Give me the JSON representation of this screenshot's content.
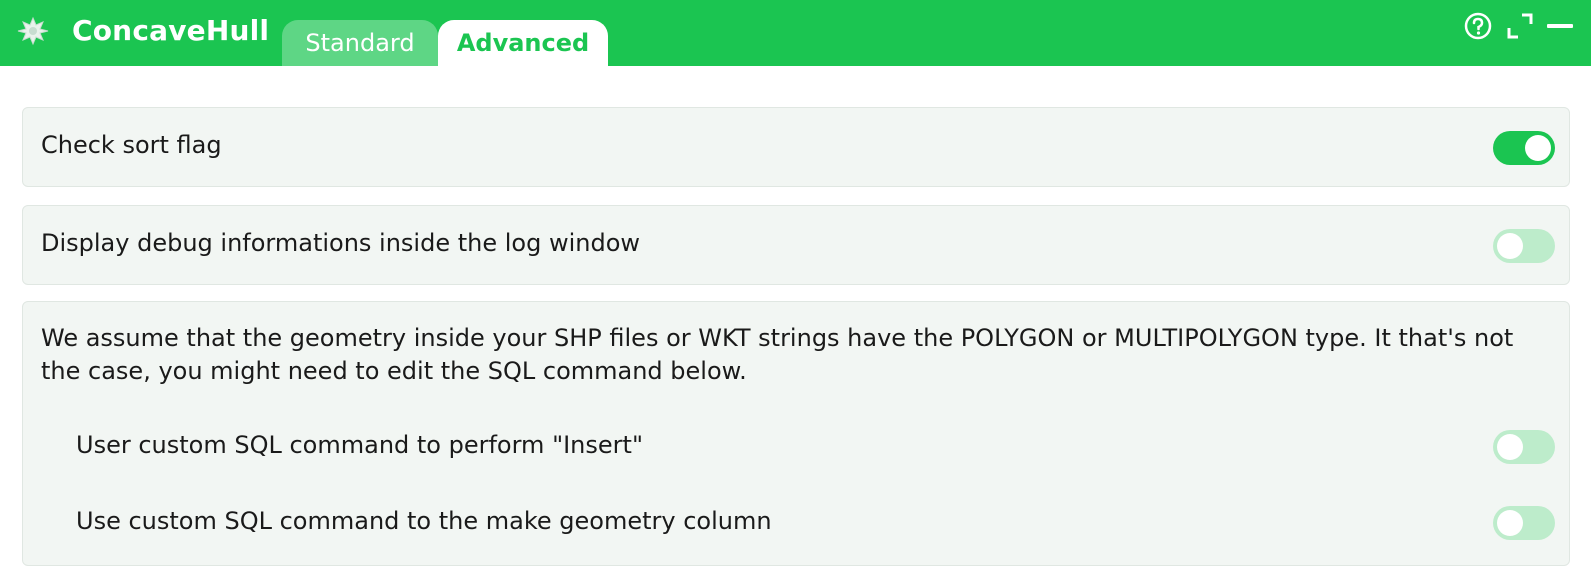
{
  "app": {
    "title": "ConcaveHull",
    "icon": "plugin-leaf-icon"
  },
  "tabs": [
    {
      "label": "Standard",
      "active": false
    },
    {
      "label": "Advanced",
      "active": true
    }
  ],
  "window_controls": [
    {
      "name": "help-icon"
    },
    {
      "name": "maximize-icon"
    },
    {
      "name": "minimize-icon"
    }
  ],
  "settings": {
    "check_sort": {
      "label": "Check sort flag",
      "enabled": true
    },
    "debug": {
      "label": "Display debug informations inside the log window",
      "enabled": false
    },
    "sql": {
      "note": "We assume that the geometry inside your SHP files or WKT strings have the POLYGON or MULTIPOLYGON type. It that's not the case, you might need to edit the SQL command below.",
      "custom_insert": {
        "label": "User custom SQL command to perform \"Insert\"",
        "enabled": false
      },
      "custom_geometry": {
        "label": "Use custom SQL command to the make geometry column",
        "enabled": false
      }
    }
  },
  "colors": {
    "accent": "#1bc551",
    "tab_inactive": "#5ed685",
    "toggle_off": "#bdeccb",
    "card_bg": "#f2f6f3"
  }
}
